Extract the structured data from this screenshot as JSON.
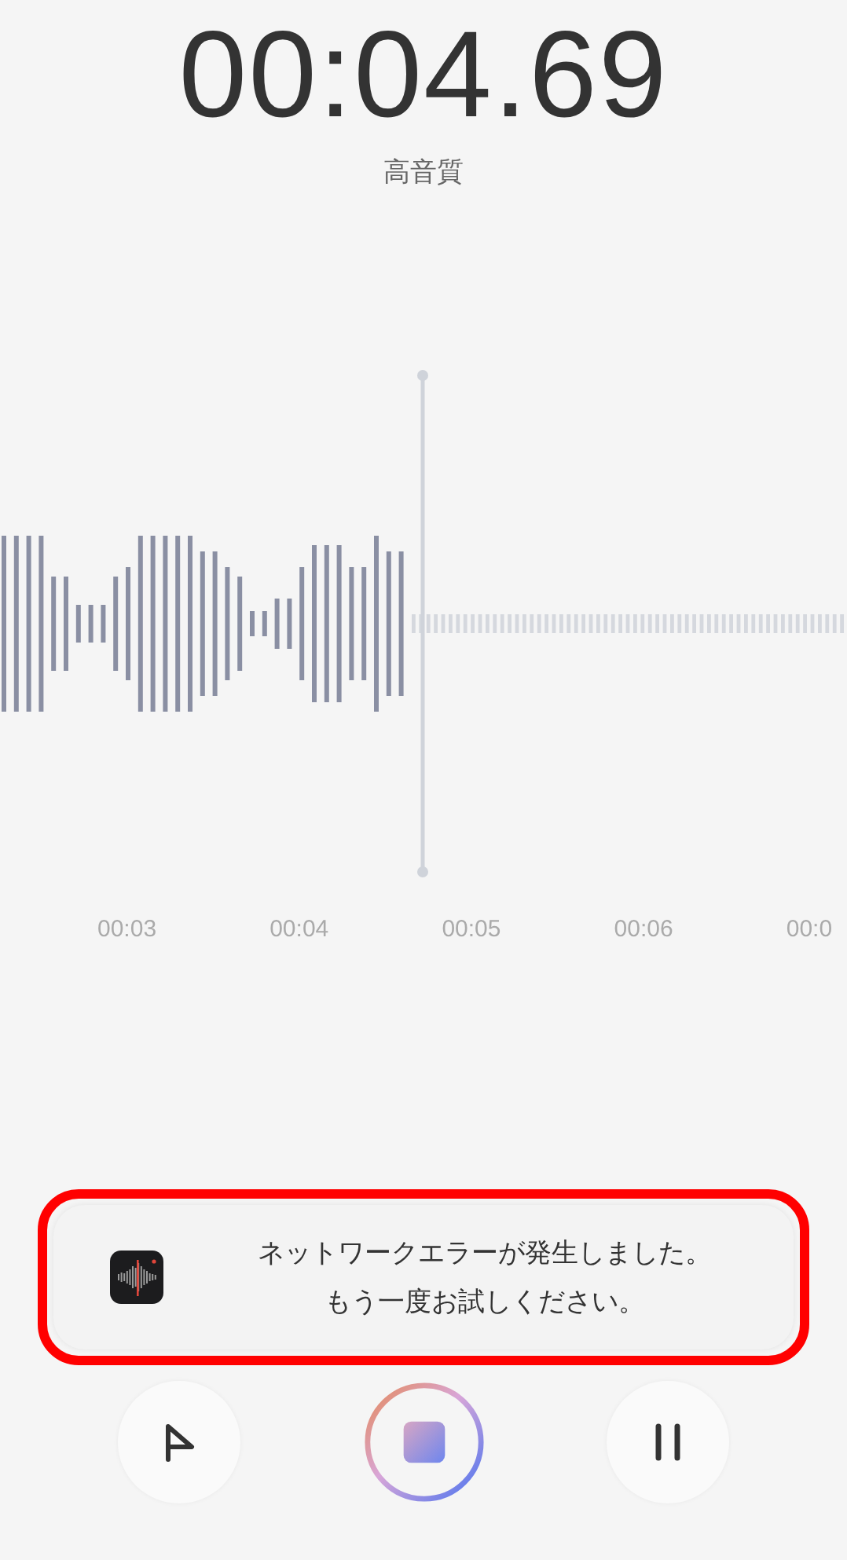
{
  "timer": "00:04.69",
  "quality": "高音質",
  "timeline": [
    "00:03",
    "00:04",
    "00:05",
    "00:06",
    "00:0"
  ],
  "toast": {
    "lines": [
      "ネットワークエラーが発生しました。",
      "もう一度お試しください。"
    ]
  }
}
